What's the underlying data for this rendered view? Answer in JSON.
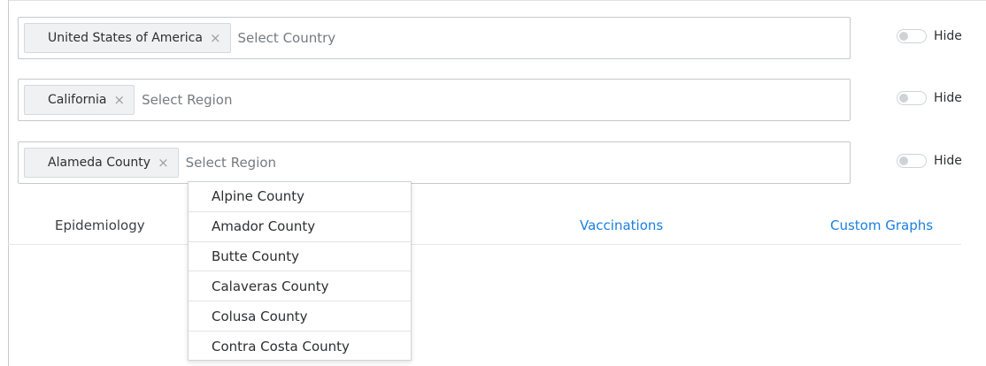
{
  "rows": [
    {
      "tag": "United States of America",
      "remove_symbol": "×",
      "placeholder": "Select Country",
      "hide_label": "Hide"
    },
    {
      "tag": "California",
      "remove_symbol": "×",
      "placeholder": "Select Region",
      "hide_label": "Hide"
    },
    {
      "tag": "Alameda County",
      "remove_symbol": "×",
      "placeholder": "Select Region",
      "hide_label": "Hide"
    }
  ],
  "tabs": [
    {
      "label": "Epidemiology",
      "state": "inactive"
    },
    {
      "label": "Vaccinations",
      "state": "link"
    },
    {
      "label": "Custom Graphs",
      "state": "link"
    }
  ],
  "dropdown": {
    "options": [
      "Alpine County",
      "Amador County",
      "Butte County",
      "Calaveras County",
      "Colusa County",
      "Contra Costa County"
    ]
  },
  "colors": {
    "link": "#1a7fe0",
    "border": "#c6c9cc",
    "tag_bg": "#f0f1f2"
  },
  "icons": {
    "tag_remove": "close-icon",
    "toggle": "toggle-switch"
  }
}
